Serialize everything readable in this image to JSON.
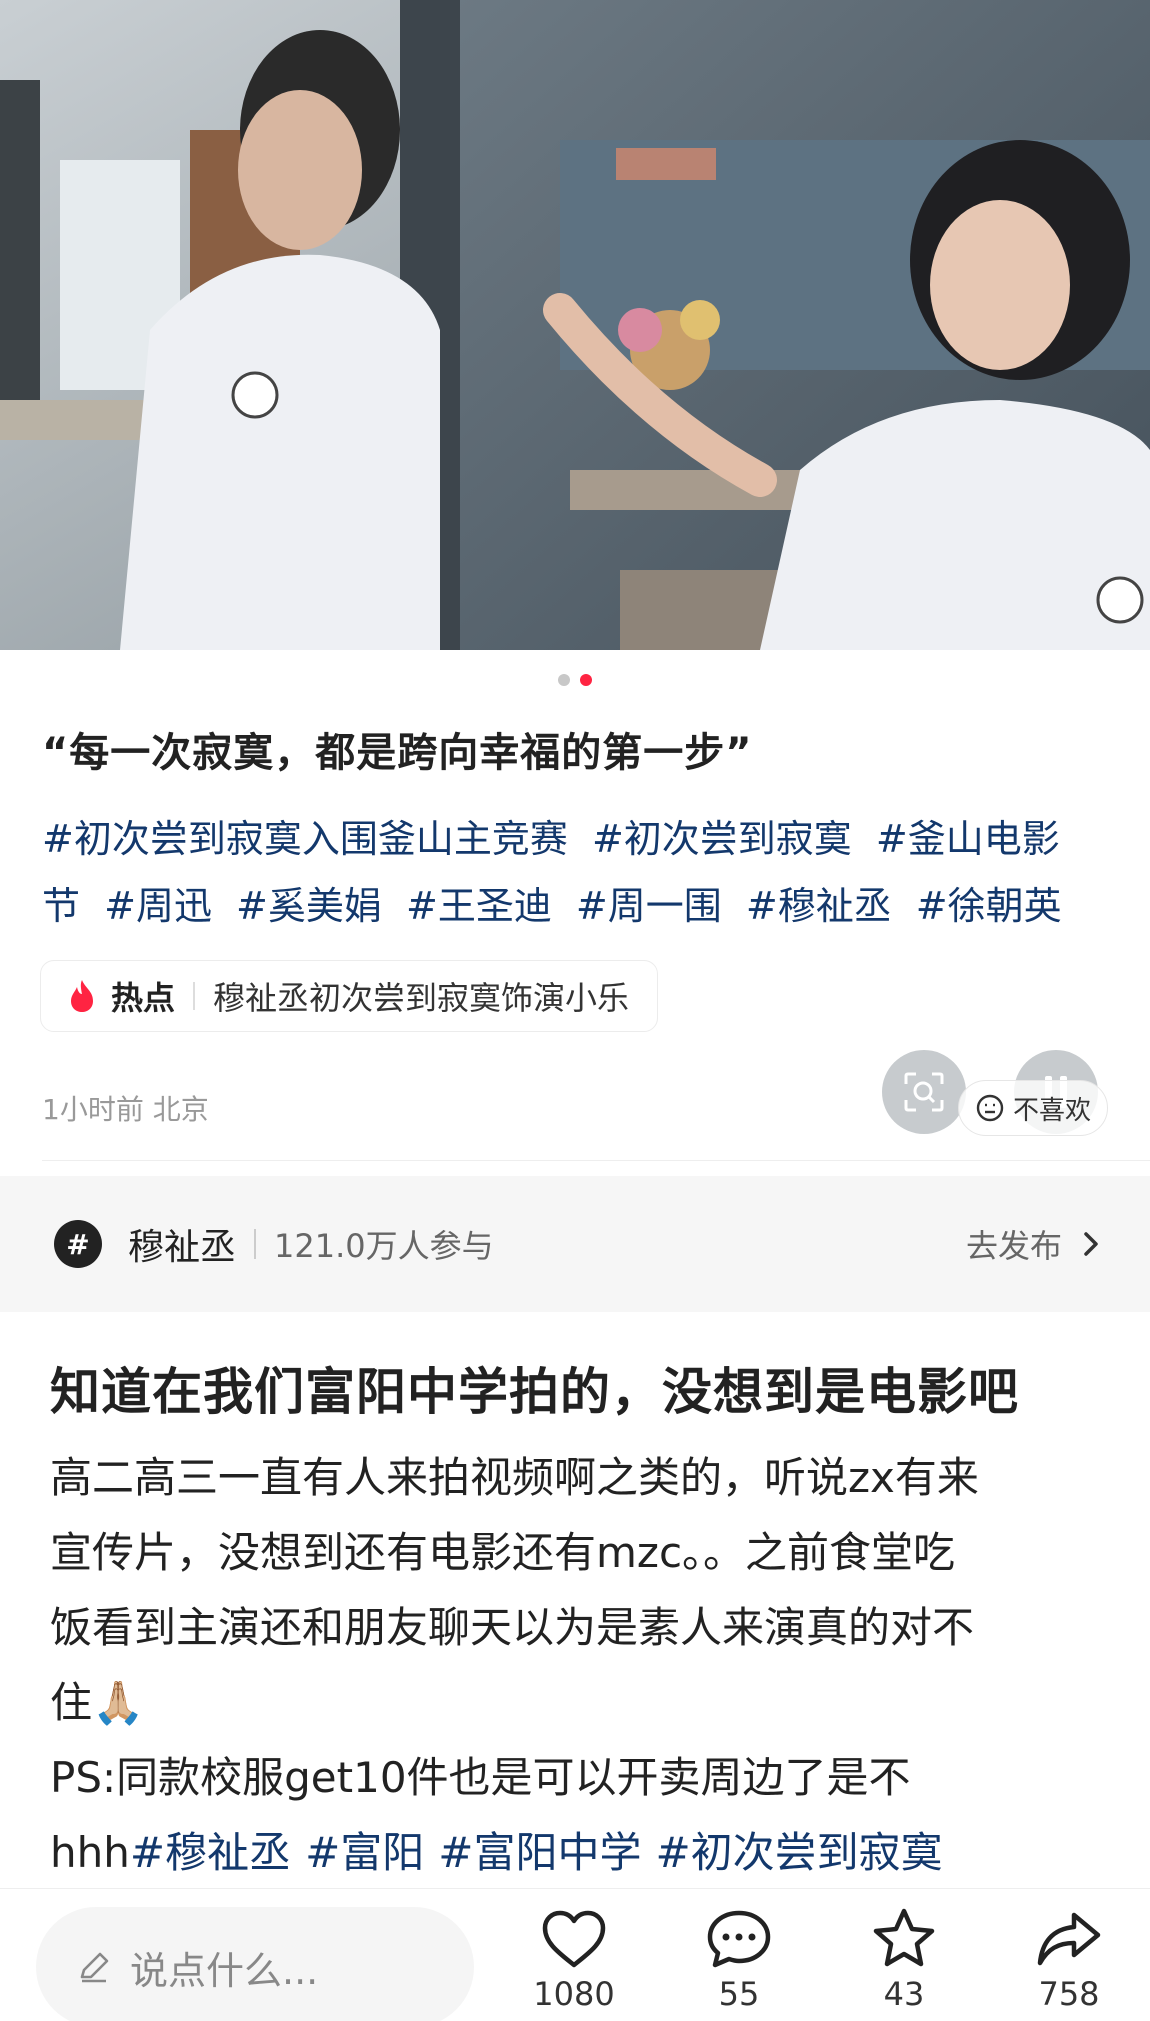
{
  "carousel": {
    "total": 2,
    "active_index": 1
  },
  "post": {
    "title": "“每一次寂寞，都是跨向幸福的第一步”",
    "tags_line1": [
      "#初次尝到寂寞入围釜山主竞赛",
      "#初次尝到寂寞",
      "#釜山电影"
    ],
    "tags_line2": [
      "节",
      "#周迅",
      "#奚美娟",
      "#王圣迪",
      "#周一围",
      "#穆祉丞",
      "#徐朝英"
    ],
    "hot": {
      "label": "热点",
      "text": "穆祉丞初次尝到寂寞饰演小乐"
    },
    "meta": "1小时前 北京",
    "dislike": "不喜欢"
  },
  "topic": {
    "icon": "#",
    "name": "穆祉丞",
    "count": "121.0万人参与",
    "action": "去发布"
  },
  "article": {
    "title": "知道在我们富阳中学拍的，没想到是电影吧",
    "line1": "高二高三一直有人来拍视频啊之类的，听说zx有来",
    "line2": "宣传片，没想到还有电影还有mzc。。之前食堂吃",
    "line3": "饭看到主演还和朋友聊天以为是素人来演真的对不",
    "line4": "住🙏🏼",
    "line5": "PS:同款校服get10件也是可以开卖周边了是不",
    "line6_prefix": "hhh",
    "line6_tags": [
      "#穆祉丞",
      "#富阳",
      "#富阳中学",
      "#初次尝到寂寞"
    ]
  },
  "bottom": {
    "placeholder": "说点什么...",
    "likes": "1080",
    "comments": "55",
    "favorites": "43",
    "shares": "758"
  },
  "colors": {
    "accent": "#ff2442",
    "tag": "#13386c"
  }
}
